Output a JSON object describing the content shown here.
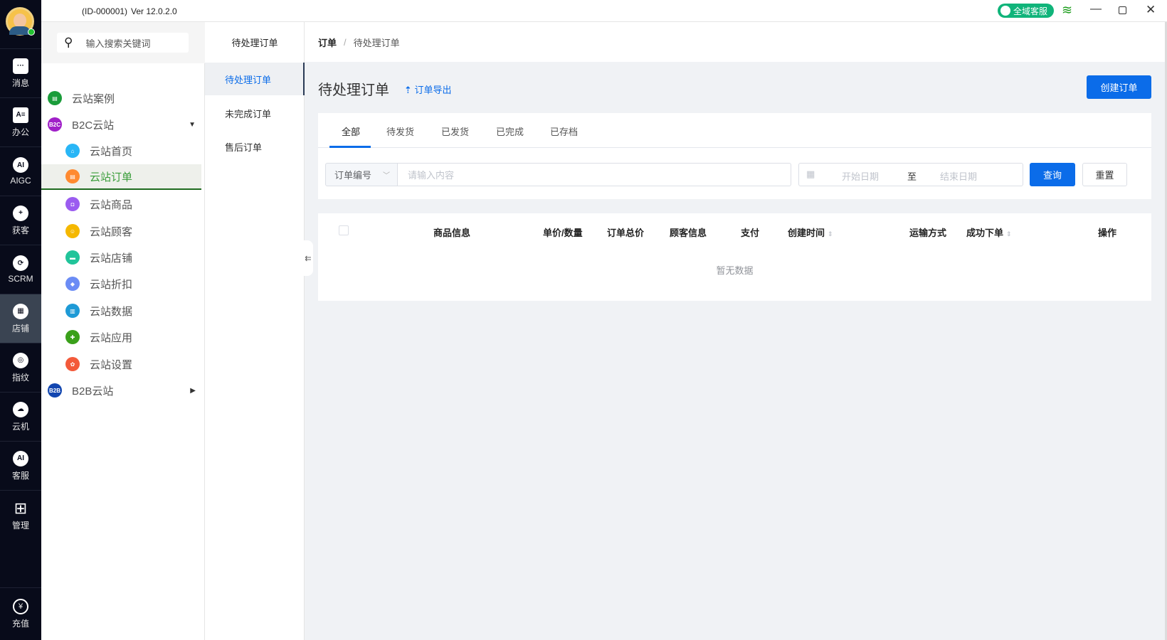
{
  "titlebar": {
    "app_id": "(ID-000001)",
    "version": "Ver 12.0.2.0",
    "service_label": "全域客服"
  },
  "rail": {
    "items": [
      {
        "label": "消息"
      },
      {
        "label": "办公"
      },
      {
        "label": "AIGC"
      },
      {
        "label": "获客"
      },
      {
        "label": "SCRM"
      },
      {
        "label": "店铺"
      },
      {
        "label": "指纹"
      },
      {
        "label": "云机"
      },
      {
        "label": "客服"
      },
      {
        "label": "管理"
      }
    ],
    "recharge": "充值",
    "active": "店铺"
  },
  "nav": {
    "search_placeholder": "输入搜索关键词",
    "items": [
      {
        "label": "云站案例",
        "color": "#1a9c3a",
        "glyph": "▤",
        "level": 0
      },
      {
        "label": "B2C云站",
        "color": "#a020c8",
        "glyph": "B2C",
        "level": 0,
        "expanded": true
      },
      {
        "label": "云站首页",
        "color": "#29b6f6",
        "glyph": "⌂",
        "level": 1
      },
      {
        "label": "云站订单",
        "color": "#ff8a30",
        "glyph": "▤",
        "level": 1,
        "selected": true
      },
      {
        "label": "云站商品",
        "color": "#9b5cf0",
        "glyph": "◘",
        "level": 1
      },
      {
        "label": "云站顾客",
        "color": "#f5b800",
        "glyph": "☺",
        "level": 1
      },
      {
        "label": "云站店铺",
        "color": "#21c49a",
        "glyph": "▬",
        "level": 1
      },
      {
        "label": "云站折扣",
        "color": "#6b8cf5",
        "glyph": "◆",
        "level": 1
      },
      {
        "label": "云站数据",
        "color": "#1e9ad6",
        "glyph": "▥",
        "level": 1
      },
      {
        "label": "云站应用",
        "color": "#3aa01a",
        "glyph": "✚",
        "level": 1
      },
      {
        "label": "云站设置",
        "color": "#f35a3a",
        "glyph": "✿",
        "level": 1
      },
      {
        "label": "B2B云站",
        "color": "#1246b0",
        "glyph": "B2B",
        "level": 0,
        "expanded": false
      }
    ]
  },
  "subnav": {
    "header": "待处理订单",
    "items": [
      {
        "label": "待处理订单",
        "selected": true
      },
      {
        "label": "未完成订单"
      },
      {
        "label": "售后订单"
      }
    ]
  },
  "breadcrumb": {
    "root": "订单",
    "sep": "/",
    "current": "待处理订单"
  },
  "main": {
    "title": "待处理订单",
    "export_label": "订单导出",
    "create_label": "创建订单",
    "tabs": [
      {
        "label": "全部",
        "active": true
      },
      {
        "label": "待发货"
      },
      {
        "label": "已发货"
      },
      {
        "label": "已完成"
      },
      {
        "label": "已存档"
      }
    ],
    "filter": {
      "field_select": "订单编号",
      "input_placeholder": "请输入内容",
      "start_placeholder": "开始日期",
      "range_sep": "至",
      "end_placeholder": "结束日期",
      "query_label": "查询",
      "reset_label": "重置"
    },
    "table": {
      "columns": [
        "商品信息",
        "单价/数量",
        "订单总价",
        "顾客信息",
        "支付",
        "创建时间",
        "运输方式",
        "成功下单",
        "操作"
      ],
      "sortable": [
        "创建时间",
        "成功下单"
      ],
      "rows": [],
      "empty_text": "暂无数据"
    }
  },
  "colors": {
    "primary": "#0b6ce9",
    "rail_bg": "#080b1a",
    "selected_green": "#3a9d3a",
    "service_green": "#10b47a"
  }
}
